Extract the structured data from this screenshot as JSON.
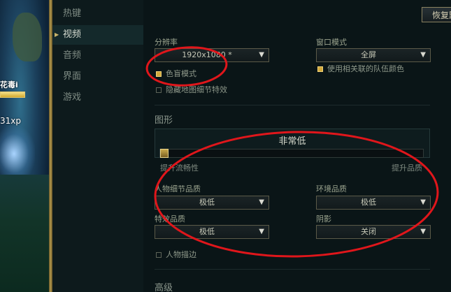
{
  "game": {
    "champion_name": "花毒i",
    "xp_text": "31xp",
    "hp_fraction": 1.0
  },
  "nav": {
    "items": [
      {
        "label": "热键",
        "active": false
      },
      {
        "label": "视频",
        "active": true
      },
      {
        "label": "音频",
        "active": false
      },
      {
        "label": "界面",
        "active": false
      },
      {
        "label": "游戏",
        "active": false
      }
    ]
  },
  "header": {
    "restore_label": "恢复默认"
  },
  "display": {
    "resolution_label": "分辨率",
    "resolution_value": "1920x1080 *",
    "window_mode_label": "窗口模式",
    "window_mode_value": "全屏",
    "colorblind_label": "色盲模式",
    "colorblind_checked": true,
    "team_color_label": "使用相关联的队伍颜色",
    "team_color_checked": true,
    "hide_eye_candy_label": "隐藏地图细节特效",
    "hide_eye_candy_checked": false
  },
  "graphics": {
    "section_title": "图形",
    "quality_level": "非常低",
    "slider_min_label": "提升流畅性",
    "slider_max_label": "提升品质",
    "slider_position": 0.0,
    "character_quality_label": "人物细节品质",
    "character_quality_value": "极低",
    "environment_quality_label": "环境品质",
    "environment_quality_value": "极低",
    "effects_quality_label": "特效品质",
    "effects_quality_value": "极低",
    "shadows_label": "阴影",
    "shadows_value": "关闭",
    "character_inking_label": "人物描边",
    "character_inking_checked": false
  },
  "advanced": {
    "section_title": "高级"
  },
  "colors": {
    "annotation_red": "#e0161b",
    "checkbox_gold": "#d2a93c",
    "panel_bg": "#0a1517"
  },
  "icons": {
    "dropdown_arrow": "▼",
    "nav_active_arrow": "▶"
  }
}
